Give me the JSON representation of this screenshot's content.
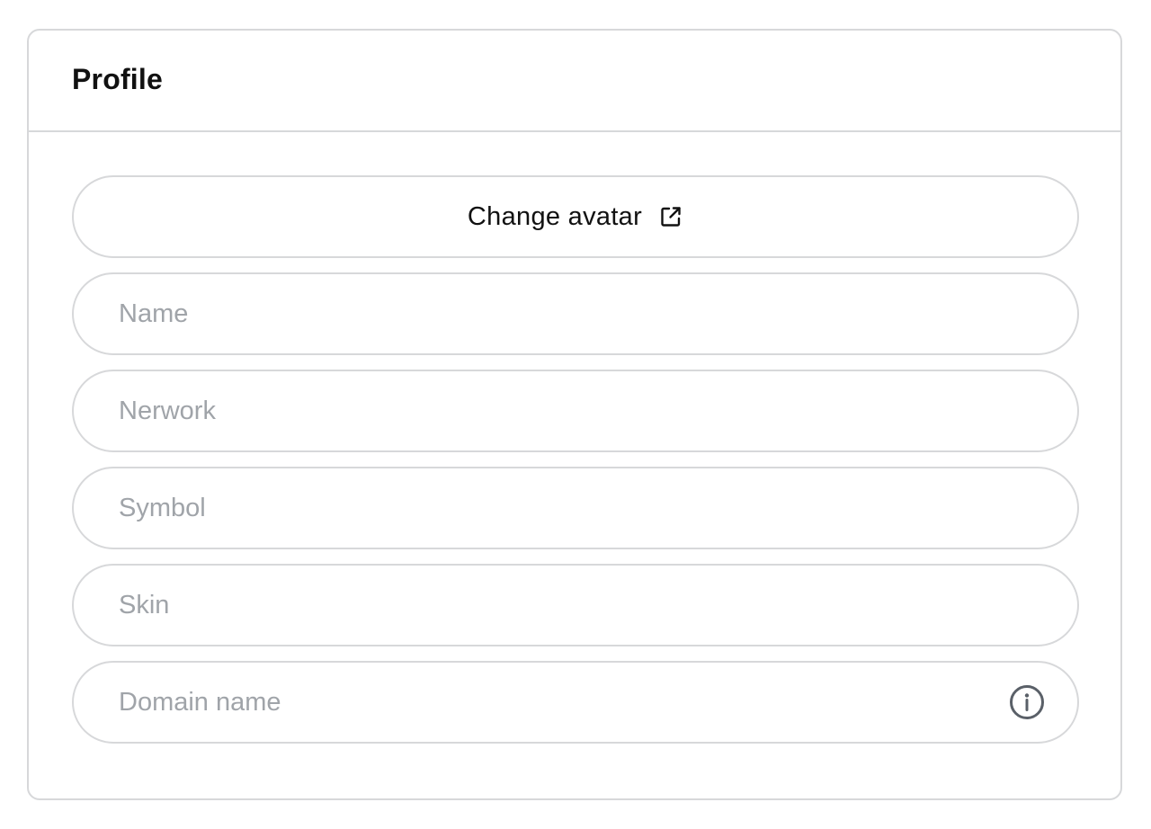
{
  "profile": {
    "title": "Profile",
    "change_avatar_label": "Change avatar",
    "change_avatar_icon": "external-link-icon",
    "fields": {
      "name": {
        "placeholder": "Name",
        "value": ""
      },
      "network": {
        "placeholder": "Nerwork",
        "value": ""
      },
      "symbol": {
        "placeholder": "Symbol",
        "value": ""
      },
      "skin": {
        "placeholder": "Skin",
        "value": ""
      },
      "domain_name": {
        "placeholder": "Domain name",
        "value": "",
        "icon": "info-icon"
      }
    }
  },
  "colors": {
    "border": "#d7d8da",
    "placeholder": "#a0a4a9",
    "text": "#111111",
    "icon": "#5a6068"
  }
}
